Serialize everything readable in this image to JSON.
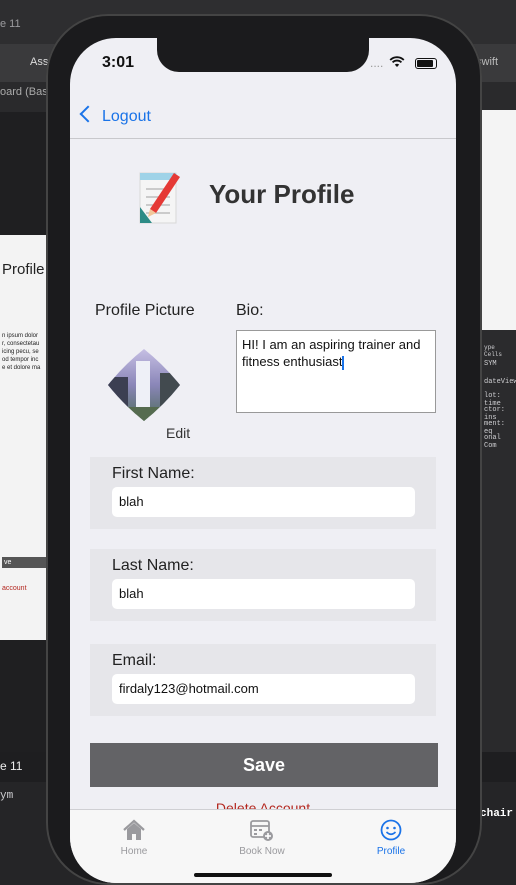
{
  "background": {
    "tab_fragment": "e 11",
    "assets_fragment": "Ass",
    "board_fragment": "oard (Bas",
    "profile_fragment": "Profile",
    "swift_fragment": "swift",
    "device_fragment": "e 11",
    "bottom_fragment": "ym",
    "chair_fragment": "chair",
    "left_lorem": [
      "n ipsum dolor",
      "r, consectetau",
      "icing pecu, se",
      "od tempor inc",
      "e et dolore ma"
    ],
    "left_list": [
      "ve",
      "account"
    ],
    "right_lines": [
      "ype Cells",
      "SYM",
      "dateView",
      "lot: time",
      "ctor: ins",
      "ment: eq",
      "onal Com"
    ]
  },
  "status": {
    "time": "3:01",
    "signal": "...."
  },
  "nav": {
    "back_label": "Logout"
  },
  "header": {
    "title": "Your Profile"
  },
  "profile": {
    "picture_label": "Profile Picture",
    "edit_label": "Edit",
    "bio_label": "Bio:",
    "bio_text": "HI! I am an aspiring trainer and fitness enthusiast"
  },
  "fields": {
    "first_name": {
      "label": "First Name:",
      "value": "blah"
    },
    "last_name": {
      "label": "Last Name:",
      "value": "blah"
    },
    "email": {
      "label": "Email:",
      "value": "firdaly123@hotmail.com"
    }
  },
  "actions": {
    "save": "Save",
    "delete": "Delete Account"
  },
  "tabs": [
    {
      "label": "Home",
      "icon": "house-icon",
      "active": false
    },
    {
      "label": "Book Now",
      "icon": "calendar-plus-icon",
      "active": false
    },
    {
      "label": "Profile",
      "icon": "smiley-icon",
      "active": true
    }
  ],
  "colors": {
    "accent": "#1a73e8",
    "destructive": "#b3261e",
    "save_button": "#636366"
  }
}
